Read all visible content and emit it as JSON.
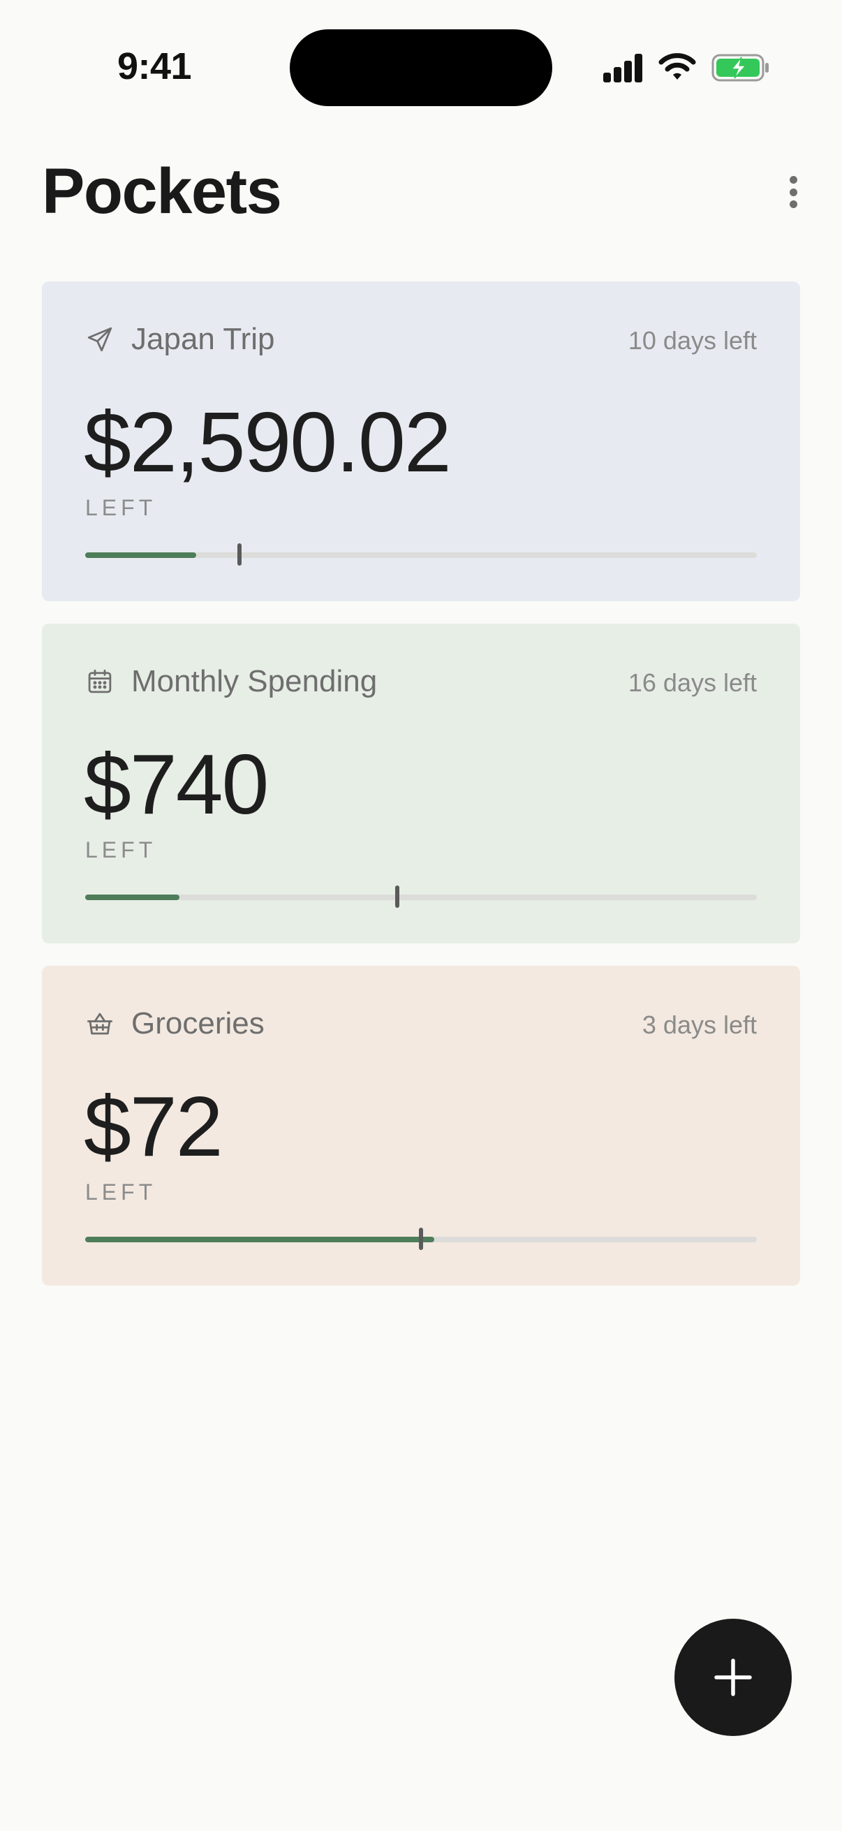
{
  "status_bar": {
    "time": "9:41",
    "icons": [
      "cellular-signal-icon",
      "wifi-icon",
      "battery-charging-icon"
    ],
    "battery_color": "#34C759"
  },
  "header": {
    "title": "Pockets",
    "menu_icon": "more-vertical-icon"
  },
  "pockets": [
    {
      "name": "Japan Trip",
      "icon": "airplane-icon",
      "days_left": "10 days left",
      "amount": "$2,590.02",
      "left_label": "LEFT",
      "background": "#E7EBF1",
      "progress": 0.165,
      "time_marker": 0.23
    },
    {
      "name": "Monthly Spending",
      "icon": "calendar-icon",
      "days_left": "16 days left",
      "amount": "$740",
      "left_label": "LEFT",
      "background": "#E7EEE6",
      "progress": 0.14,
      "time_marker": 0.465
    },
    {
      "name": "Groceries",
      "icon": "basket-icon",
      "days_left": "3 days left",
      "amount": "$72",
      "left_label": "LEFT",
      "background": "#F3E9E0",
      "progress": 0.52,
      "time_marker": 0.5
    }
  ],
  "colors": {
    "progress_fill": "#4E7D5A",
    "progress_track": "#DCDCDA",
    "fab_background": "#1A1A1A"
  },
  "fab": {
    "icon": "plus-icon"
  }
}
